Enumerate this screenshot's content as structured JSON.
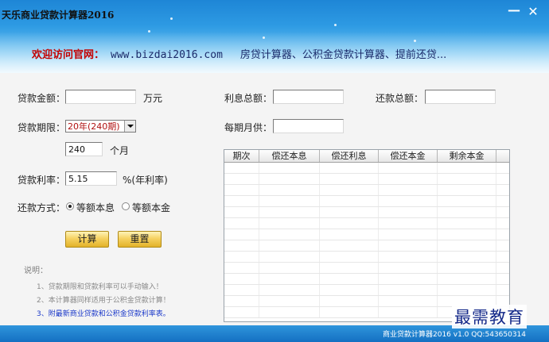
{
  "window": {
    "title": "天乐商业贷款计算器2016",
    "minimize_glyph": "—",
    "close_glyph": "✕"
  },
  "banner": {
    "welcome_label": "欢迎访问官网：",
    "welcome_url": "www.bizdai2016.com",
    "welcome_desc": "房贷计算器、公积金贷款计算器、提前还贷..."
  },
  "form": {
    "amount_label": "贷款金额：",
    "amount_value": "",
    "amount_unit": "万元",
    "term_label": "贷款期限：",
    "term_selected": "20年(240期)",
    "term_months_value": "240",
    "term_months_unit": "个月",
    "rate_label": "贷款利率：",
    "rate_value": "5.15",
    "rate_unit": "%(年利率)",
    "method_label": "还款方式：",
    "method_options": [
      {
        "label": "等额本息",
        "checked": true
      },
      {
        "label": "等额本金",
        "checked": false
      }
    ],
    "calculate_label": "计算",
    "reset_label": "重置"
  },
  "results": {
    "total_interest_label": "利息总额：",
    "total_interest_value": "",
    "total_repayment_label": "还款总额：",
    "total_repayment_value": "",
    "monthly_payment_label": "每期月供：",
    "monthly_payment_value": ""
  },
  "schedule": {
    "columns": [
      "期次",
      "偿还本息",
      "偿还利息",
      "偿还本金",
      "剩余本金"
    ],
    "rows": []
  },
  "notes": {
    "title": "说明：",
    "items": [
      "1、贷款期限和贷款利率可以手动输入！",
      "2、本计算器同样适用于公积金贷款计算！"
    ],
    "link": "3、附最新商业贷款和公积金贷款利率表。"
  },
  "statusbar": {
    "text": "商业贷款计算器2016 v1.0  QQ:543650314"
  },
  "watermark": {
    "text": "最需教育"
  },
  "colors": {
    "banner_top": "#1e86d6",
    "banner_bottom": "#b6e2fa",
    "welcome_red": "#c40000",
    "button_gold": "#f6d262",
    "status_blue": "#1470c2",
    "link_blue": "#1a38c9"
  }
}
